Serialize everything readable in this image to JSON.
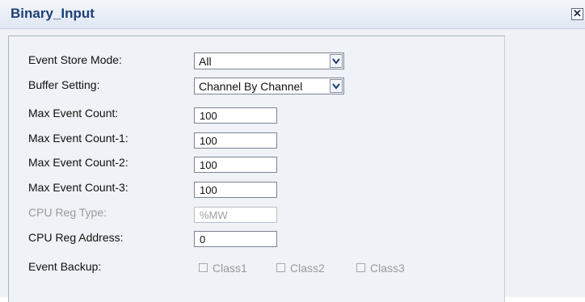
{
  "window": {
    "title": "Binary_Input",
    "close_glyph": "✕"
  },
  "fields": {
    "event_store_mode": {
      "label": "Event Store Mode:",
      "value": "All"
    },
    "buffer_setting": {
      "label": "Buffer Setting:",
      "value": "Channel By Channel"
    },
    "max_event_count": {
      "label": "Max Event Count:",
      "value": "100"
    },
    "max_event_count_1": {
      "label": "Max Event Count-1:",
      "value": "100"
    },
    "max_event_count_2": {
      "label": "Max Event Count-2:",
      "value": "100"
    },
    "max_event_count_3": {
      "label": "Max Event Count-3:",
      "value": "100"
    },
    "cpu_reg_type": {
      "label": "CPU Reg Type:",
      "placeholder": "%MW",
      "disabled": true
    },
    "cpu_reg_address": {
      "label": "CPU Reg Address:",
      "value": "0"
    },
    "event_backup": {
      "label": "Event Backup:",
      "options": [
        {
          "label": "Class1",
          "checked": false,
          "disabled": true
        },
        {
          "label": "Class2",
          "checked": false,
          "disabled": true
        },
        {
          "label": "Class3",
          "checked": false,
          "disabled": true
        }
      ]
    }
  },
  "colors": {
    "title_text": "#1d3f78",
    "panel_bg": "#eff2f6",
    "disabled_text": "#9a9a9a"
  }
}
